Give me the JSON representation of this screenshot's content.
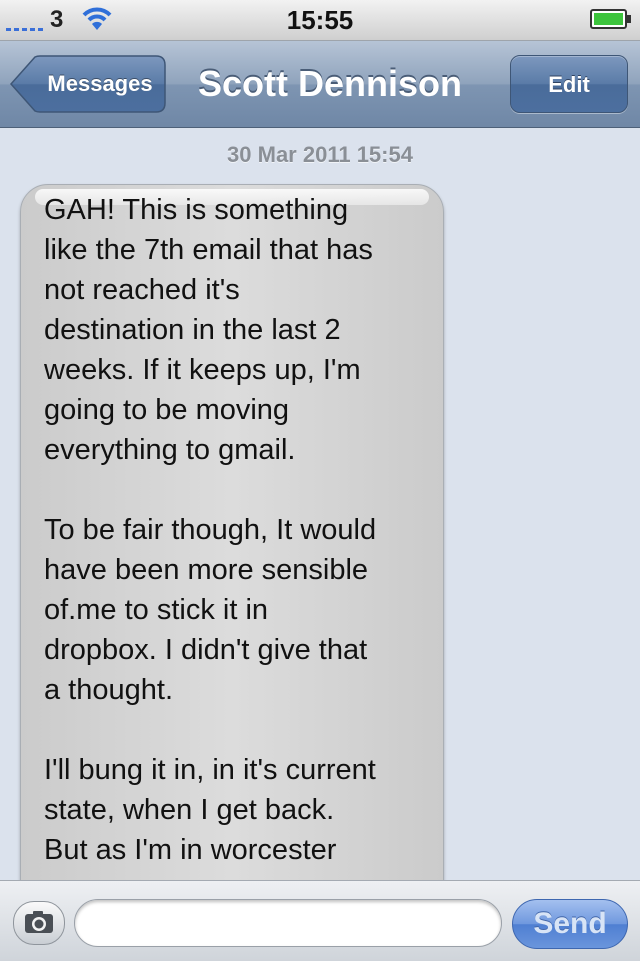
{
  "status_bar": {
    "carrier": "3",
    "time": "15:55"
  },
  "nav": {
    "back_label": "Messages",
    "title": "Scott Dennison",
    "edit_label": "Edit"
  },
  "conversation": {
    "timestamp": "30 Mar 2011 15:54",
    "message": {
      "paragraphs": [
        [
          "GAH! This is something",
          "like the 7th email that has",
          "not reached it's",
          "destination in the last 2",
          "weeks. If it keeps up, I'm",
          "going to be moving",
          "everything to gmail."
        ],
        [
          "To be fair though, It would",
          "have been more sensible",
          "of.me to stick it in",
          "dropbox. I didn't give that",
          "a thought."
        ],
        [
          "I'll bung it in, in it's current",
          "state, when I get back.",
          "But as I'm in worcester"
        ]
      ]
    }
  },
  "input_bar": {
    "text_value": "",
    "send_label": "Send"
  },
  "colors": {
    "background": "#dbe2ed",
    "nav_bar": "#8fa3bc",
    "bubble": "#d4d4d4",
    "send_button": "#5b88d6",
    "battery_fill": "#3cc43c"
  }
}
